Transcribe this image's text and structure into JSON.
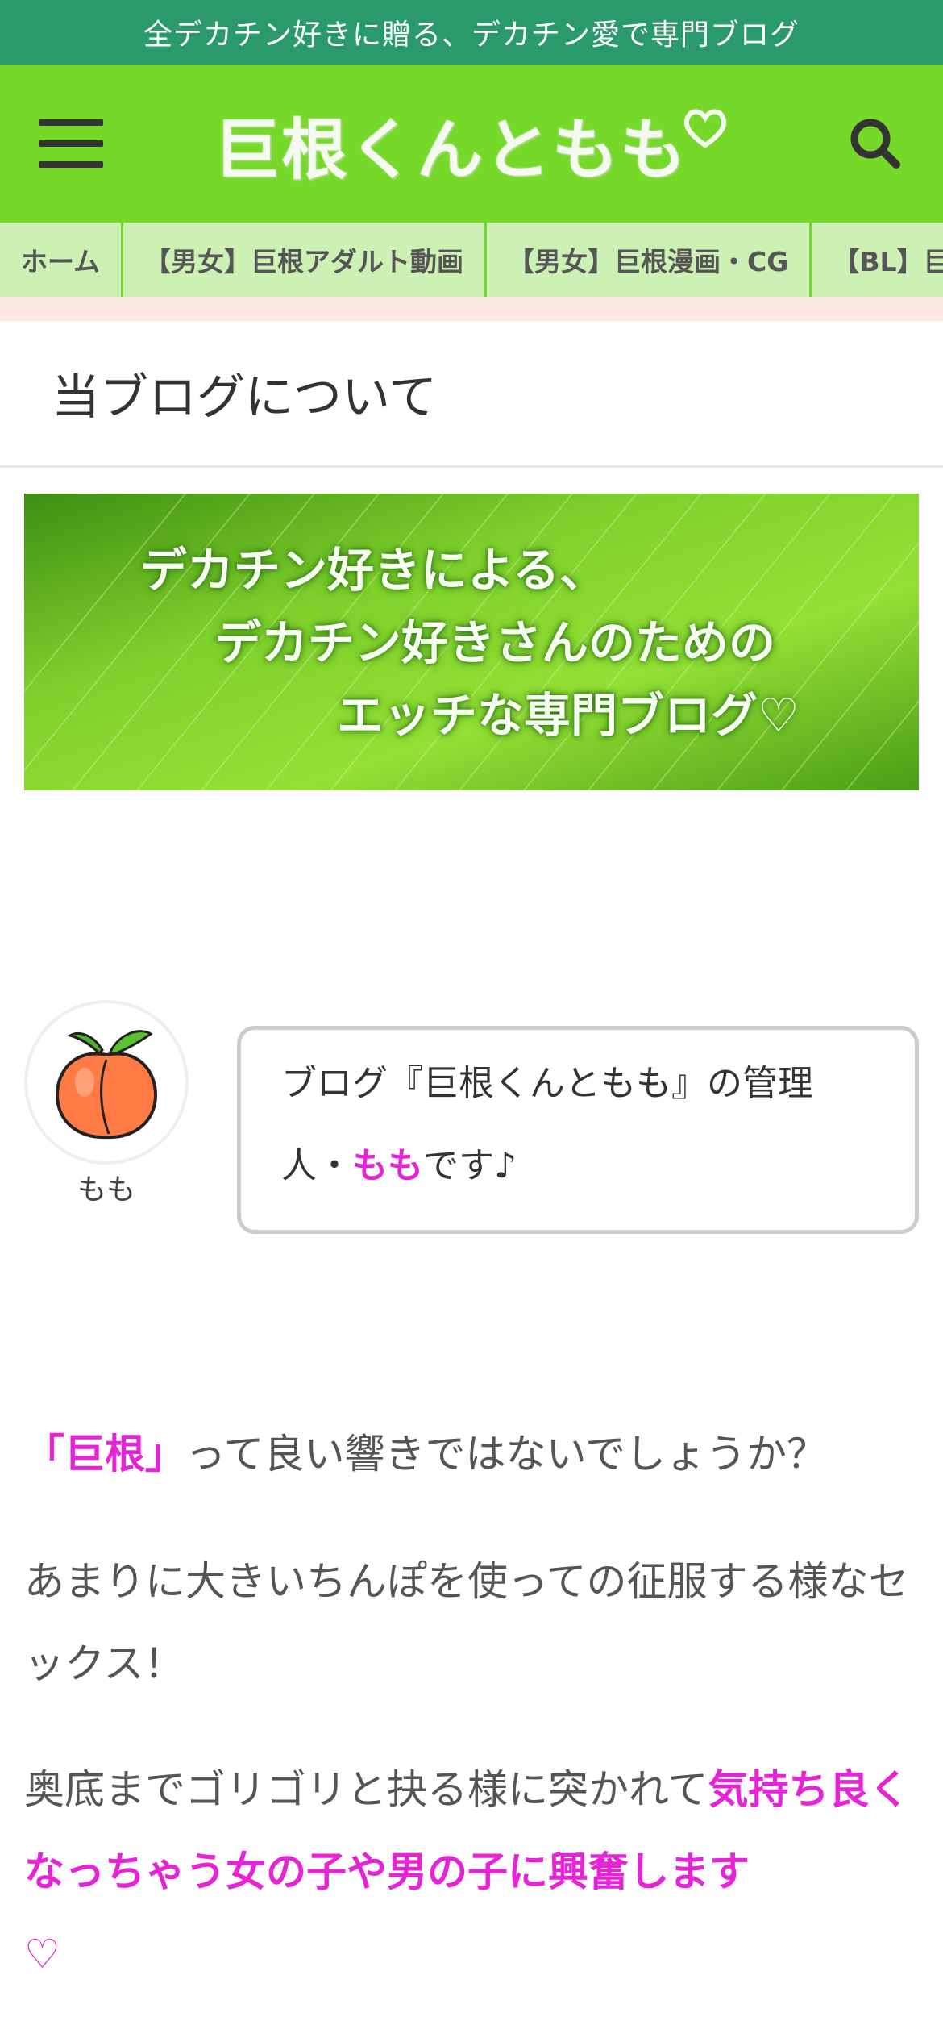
{
  "topbar": {
    "tagline": "全デカチン好きに贈る、デカチン愛で専門ブログ"
  },
  "header": {
    "logo": "巨根くんともも",
    "menu_icon": "hamburger-menu-icon",
    "search_icon": "search-icon",
    "brand_color": "#76d92a"
  },
  "nav": {
    "items": [
      {
        "label": "ホーム"
      },
      {
        "label": "【男女】巨根アダルト動画"
      },
      {
        "label": "【男女】巨根漫画・CG"
      },
      {
        "label": "【BL】巨根"
      }
    ]
  },
  "page": {
    "title": "当ブログについて"
  },
  "banner": {
    "line1": "デカチン好きによる、",
    "line2": "デカチン好きさんのための",
    "line3": "エッチな専門ブログ♡"
  },
  "speech": {
    "avatar_icon": "peach-icon",
    "name": "もも",
    "text_part1": "ブログ『巨根くんともも』の管理",
    "text_part2": "人・",
    "text_highlight": "もも",
    "text_part3": "です♪"
  },
  "content": {
    "p1_highlight": "「巨根」",
    "p1_rest": "って良い響きではないでしょうか？",
    "p2": "あまりに大きいちんぽを使っての征服する様なセックス！",
    "p3_start": "奥底までゴリゴリと抉る様に突かれて",
    "p3_highlight": "気持ち良くなっちゃう女の子や男の子に興奮します",
    "p3_heart": "♡",
    "highlight_color": "#e524d6"
  }
}
